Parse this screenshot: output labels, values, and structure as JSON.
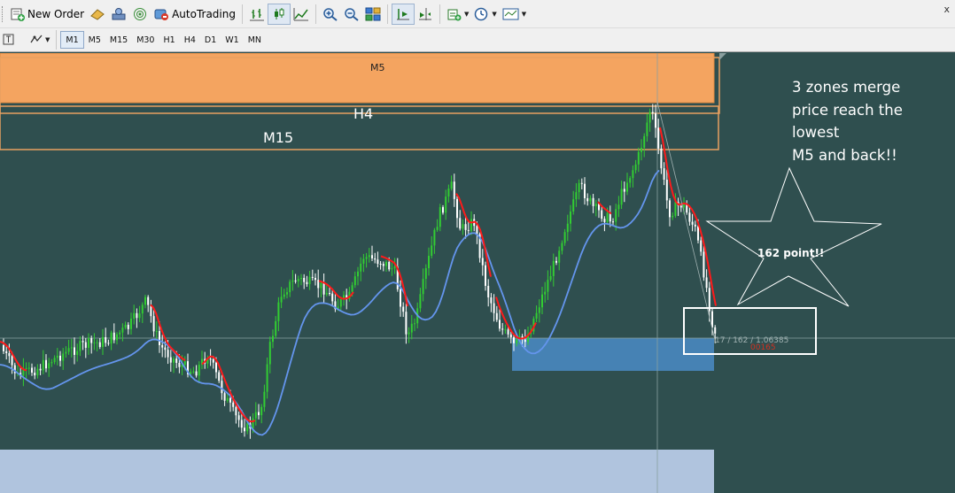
{
  "toolbar": {
    "new_order_label": "New Order",
    "autotrading_label": "AutoTrading",
    "close_glyph": "x"
  },
  "timeframes": [
    "M1",
    "M5",
    "M15",
    "M30",
    "H1",
    "H4",
    "D1",
    "W1",
    "MN"
  ],
  "active_timeframe": "M1",
  "zones": {
    "m5_label": "M5",
    "h4_label": "H4",
    "m15_label": "M15"
  },
  "annotations": {
    "lines": [
      "3 zones merge",
      "price reach the",
      "lowest",
      "M5  and back!!"
    ],
    "star_label": "162 point!!"
  },
  "cursor_readout": {
    "text": "17 / 162 / 1.06385",
    "red_text": "00165"
  },
  "colors": {
    "background": "#2f4f4f",
    "bull_candle": "#32cd32",
    "bear_candle": "#ffffff",
    "fast_ma": "#ff1a1a",
    "slow_ma": "#6495ed",
    "zone_m5": "#f4a460",
    "zone_blue": "#4682b4",
    "zone_lightblue": "#b0c4de"
  },
  "icons": [
    "new-order-icon",
    "market-watch-icon",
    "navigator-icon",
    "signals-icon",
    "autotrading-icon",
    "bar-chart-icon",
    "candlestick-icon",
    "line-chart-icon",
    "zoom-in-icon",
    "zoom-out-icon",
    "tile-windows-icon",
    "autoscroll-icon",
    "chart-shift-icon",
    "indicators-icon",
    "periods-icon",
    "templates-icon",
    "crosshair-icon",
    "line-studies-icon"
  ]
}
